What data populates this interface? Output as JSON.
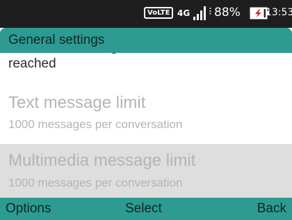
{
  "status_bar": {
    "volte": "VoLTE",
    "network": "4G",
    "battery_percent": "88%",
    "battery_level": 0.88,
    "time": "13:53",
    "icons": [
      "signal-icon",
      "battery-charging-icon"
    ]
  },
  "header": {
    "title": "General settings"
  },
  "settings": {
    "cut_item_description": "Delete old messages as limits are reached",
    "items": [
      {
        "title": "Text message limit",
        "subtitle": "1000 messages per conversation",
        "selected": false
      },
      {
        "title": "Multimedia message limit",
        "subtitle": "1000 messages per conversation",
        "selected": true
      }
    ]
  },
  "softkeys": {
    "left": "Options",
    "center": "Select",
    "right": "Back"
  },
  "colors": {
    "accent": "#2e9b92",
    "status_bar": "#1e1e1e",
    "selected_row": "#dedede",
    "disabled_text": "#b4b4b4"
  }
}
